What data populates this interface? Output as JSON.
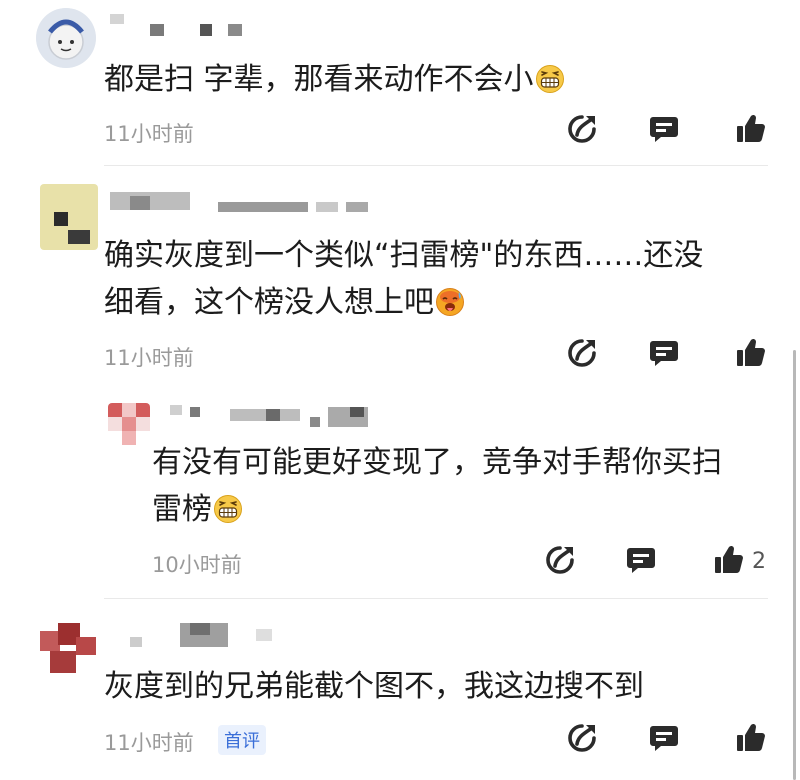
{
  "comments": [
    {
      "text": "都是扫 字辈，那看来动作不会小",
      "emoji": "grinning-squint-emoji",
      "time": "11小时前"
    },
    {
      "text_line1": "确实灰度到一个类似“扫雷榜\"的东西……还没",
      "text_line2": "细看，这个榜没人想上吧",
      "emoji": "hot-face-emoji",
      "time": "11小时前"
    },
    {
      "text_line1": "有没有可能更好变现了，竞争对手帮你买扫",
      "text_line2": "雷榜",
      "emoji": "grinning-squint-emoji",
      "time": "10小时前",
      "like_count": "2"
    },
    {
      "text": "灰度到的兄弟能截个图不，我这边搜不到",
      "time": "11小时前",
      "badge": "首评"
    }
  ],
  "icons": {
    "share": "share-icon",
    "reply": "comment-icon",
    "like": "thumbs-up-icon"
  },
  "colors": {
    "icon": "#2b2b2b",
    "time": "#9a9a9a",
    "badge_text": "#3b6fd8",
    "badge_bg": "#eaf1fd"
  }
}
